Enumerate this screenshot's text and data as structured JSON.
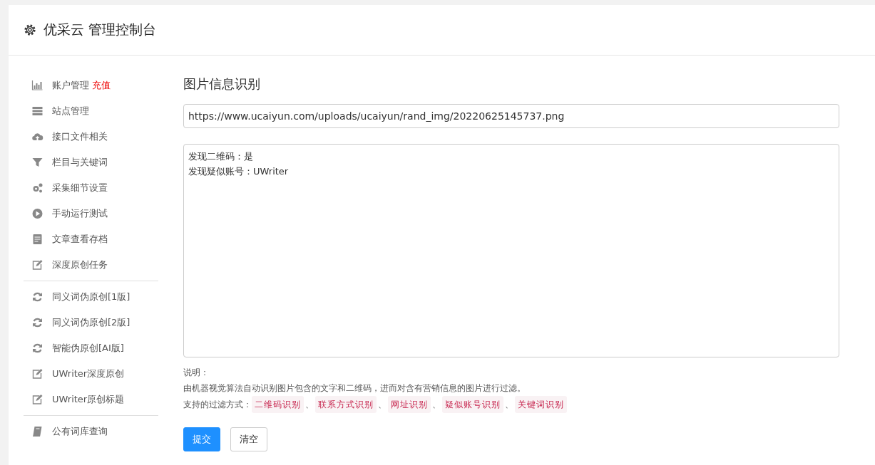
{
  "header": {
    "title": "优采云 管理控制台"
  },
  "sidebar": {
    "groups": [
      {
        "items": [
          {
            "label": "账户管理",
            "badge": "充值"
          },
          {
            "label": "站点管理"
          },
          {
            "label": "接口文件相关"
          },
          {
            "label": "栏目与关键词"
          },
          {
            "label": "采集细节设置"
          },
          {
            "label": "手动运行测试"
          },
          {
            "label": "文章查看存档"
          },
          {
            "label": "深度原创任务"
          }
        ]
      },
      {
        "items": [
          {
            "label": "同义词伪原创[1版]"
          },
          {
            "label": "同义词伪原创[2版]"
          },
          {
            "label": "智能伪原创[AI版]"
          },
          {
            "label": "UWriter深度原创"
          },
          {
            "label": "UWriter原创标题"
          }
        ]
      },
      {
        "items": [
          {
            "label": "公有词库查询"
          }
        ]
      }
    ]
  },
  "main": {
    "title": "图片信息识别",
    "url_field": {
      "value": "https://www.ucaiyun.com/uploads/ucaiyun/rand_img/20220625145737.png"
    },
    "result_box": {
      "lines": [
        "发现二维码：是",
        "发现疑似账号：UWriter"
      ]
    },
    "notes": {
      "heading": "说明：",
      "description": "由机器视觉算法自动识别图片包含的文字和二维码，进而对含有营销信息的图片进行过滤。",
      "methods_label": "支持的过滤方式：",
      "separator": "、",
      "methods": [
        "二维码识别",
        "联系方式识别",
        "网址识别",
        "疑似账号识别",
        "关键词识别"
      ]
    },
    "buttons": [
      {
        "label": "提交",
        "kind": "primary"
      },
      {
        "label": "清空",
        "kind": "default"
      }
    ]
  }
}
